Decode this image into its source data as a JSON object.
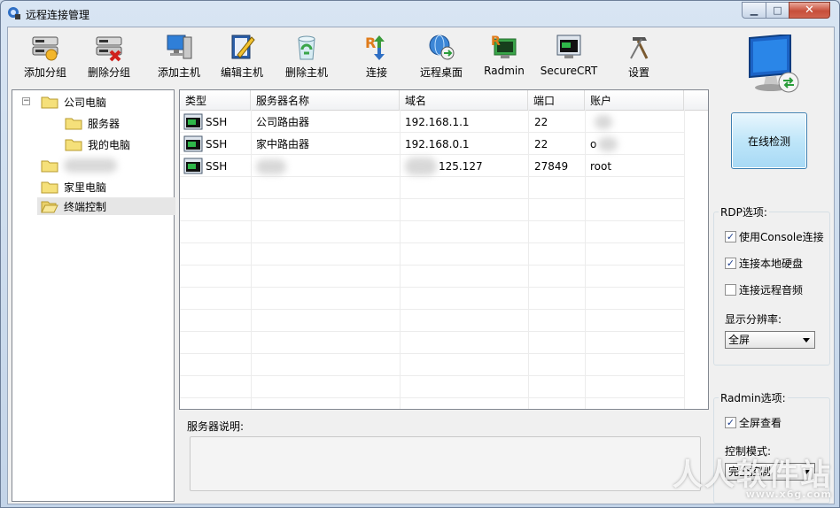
{
  "window": {
    "title": "远程连接管理"
  },
  "toolbar": {
    "add_group": "添加分组",
    "delete_group": "删除分组",
    "add_host": "添加主机",
    "edit_host": "编辑主机",
    "delete_host": "删除主机",
    "connect": "连接",
    "remote_desktop": "远程桌面",
    "radmin": "Radmin",
    "securecrt": "SecureCRT",
    "settings": "设置"
  },
  "tree": {
    "company": "公司电脑",
    "servers": "服务器",
    "my_computer": "我的电脑",
    "home": "家里电脑",
    "terminal": "终端控制"
  },
  "list": {
    "columns": {
      "type": "类型",
      "name": "服务器名称",
      "domain": "域名",
      "port": "端口",
      "account": "账户"
    },
    "rows": [
      {
        "type": "SSH",
        "name": "公司路由器",
        "domain": "192.168.1.1",
        "port": "22",
        "account": ""
      },
      {
        "type": "SSH",
        "name": "家中路由器",
        "domain": "192.168.0.1",
        "port": "22",
        "account": "o"
      },
      {
        "type": "SSH",
        "name": "",
        "domain": "125.127",
        "port": "27849",
        "account": "root"
      }
    ]
  },
  "description": {
    "label": "服务器说明:"
  },
  "right": {
    "check_button": "在线检测",
    "rdp_title": "RDP选项:",
    "rdp_console": "使用Console连接",
    "rdp_disk": "连接本地硬盘",
    "rdp_audio": "连接远程音频",
    "resolution_label": "显示分辨率:",
    "resolution_value": "全屏",
    "radmin_title": "Radmin选项:",
    "radmin_fullscreen": "全屏查看",
    "control_mode_label": "控制模式:",
    "control_mode_value": "完全控制"
  },
  "checkboxes": {
    "rdp_console": true,
    "rdp_disk": true,
    "rdp_audio": false,
    "radmin_fullscreen": true
  },
  "watermark": {
    "text": "人人软件站",
    "url": "www.x6g.com"
  }
}
